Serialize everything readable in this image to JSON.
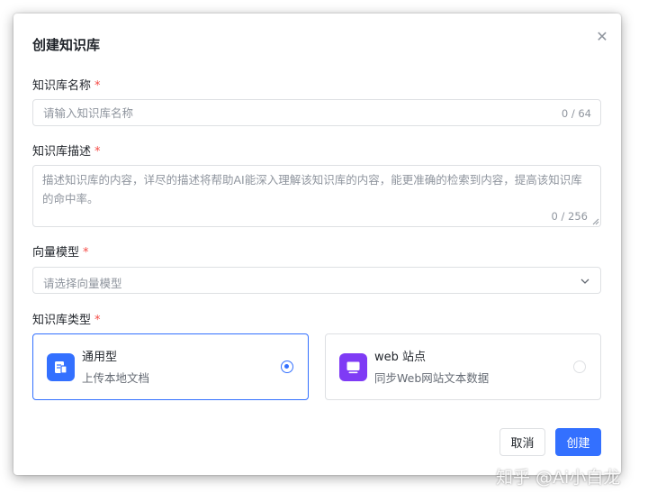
{
  "dialog": {
    "title": "创建知识库",
    "close_icon": "close-icon"
  },
  "form": {
    "name": {
      "label": "知识库名称",
      "required_mark": "*",
      "placeholder": "请输入知识库名称",
      "value": "",
      "counter": "0 / 64"
    },
    "description": {
      "label": "知识库描述",
      "required_mark": "*",
      "placeholder": "描述知识库的内容，详尽的描述将帮助AI能深入理解该知识库的内容，能更准确的检索到内容，提高该知识库的命中率。",
      "value": "",
      "counter": "0 / 256"
    },
    "embedding_model": {
      "label": "向量模型",
      "required_mark": "*",
      "placeholder": "请选择向量模型",
      "selected": ""
    },
    "kb_type": {
      "label": "知识库类型",
      "required_mark": "*",
      "options": [
        {
          "name": "通用型",
          "desc": "上传本地文档",
          "icon": "document-icon",
          "selected": true
        },
        {
          "name": "web 站点",
          "desc": "同步Web网站文本数据",
          "icon": "monitor-icon",
          "selected": false
        }
      ]
    }
  },
  "actions": {
    "cancel_label": "取消",
    "create_label": "创建"
  },
  "watermark": "知乎 @Ai小白龙",
  "colors": {
    "primary": "#3370ff",
    "required": "#f54a45",
    "web_icon_bg": "#7f3bf5"
  }
}
